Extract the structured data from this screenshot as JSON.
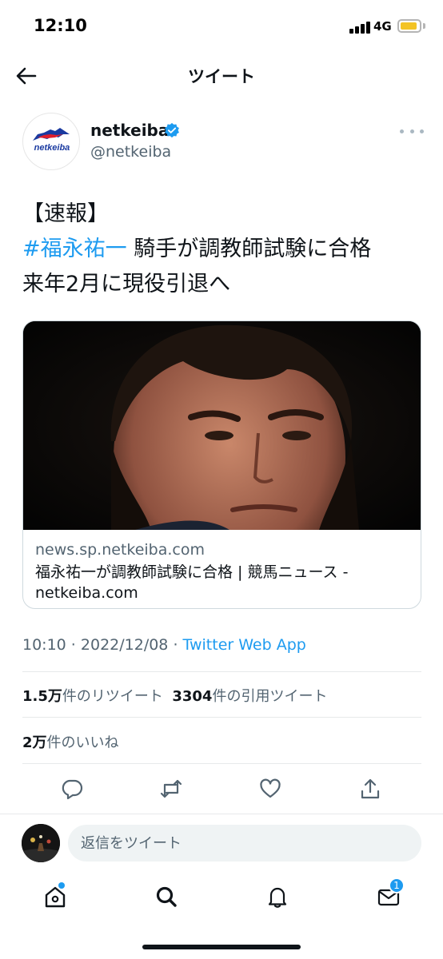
{
  "status_bar": {
    "time": "12:10",
    "network": "4G"
  },
  "header": {
    "title": "ツイート"
  },
  "tweet": {
    "author": {
      "name": "netkeiba",
      "handle": "@netkeiba",
      "logo_text": "netkeiba"
    },
    "text_line1": "【速報】",
    "hashtag": "#福永祐一",
    "text_line2_rest": " 騎手が調教師試験に合格",
    "text_line3": "来年2月に現役引退へ",
    "card": {
      "domain": "news.sp.netkeiba.com",
      "title": "福永祐一が調教師試験に合格 | 競馬ニュース - netkeiba.com"
    },
    "meta": {
      "time": "10:10",
      "separator": " · ",
      "date": "2022/12/08",
      "source": "Twitter Web App"
    },
    "stats": {
      "retweets": "1.5万",
      "retweets_label": "件のリツイート",
      "quotes": "3304",
      "quotes_label": "件の引用ツイート",
      "likes": "2万",
      "likes_label": "件のいいね"
    }
  },
  "actions": [
    "reply-icon",
    "retweet-icon",
    "like-icon",
    "share-icon"
  ],
  "reply": {
    "placeholder": "返信をツイート"
  },
  "tab_bar": {
    "messages_badge": "1"
  },
  "colors": {
    "accent": "#1d9bf0",
    "secondary_text": "#536471",
    "battery": "#f3c324"
  }
}
